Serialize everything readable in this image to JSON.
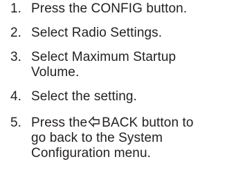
{
  "steps": [
    {
      "number": "1.",
      "lines": [
        "Press the CONFIG button."
      ]
    },
    {
      "number": "2.",
      "lines": [
        "Select Radio Settings."
      ]
    },
    {
      "number": "3.",
      "lines": [
        "Select Maximum Startup",
        "Volume."
      ]
    },
    {
      "number": "4.",
      "lines": [
        "Select the setting."
      ]
    },
    {
      "number": "5.",
      "line1_before_icon": "Press the",
      "icon": "back-arrow-icon",
      "line1_after_icon": "BACK button to",
      "lines_rest": [
        "go back to the System",
        "Configuration menu."
      ]
    }
  ]
}
